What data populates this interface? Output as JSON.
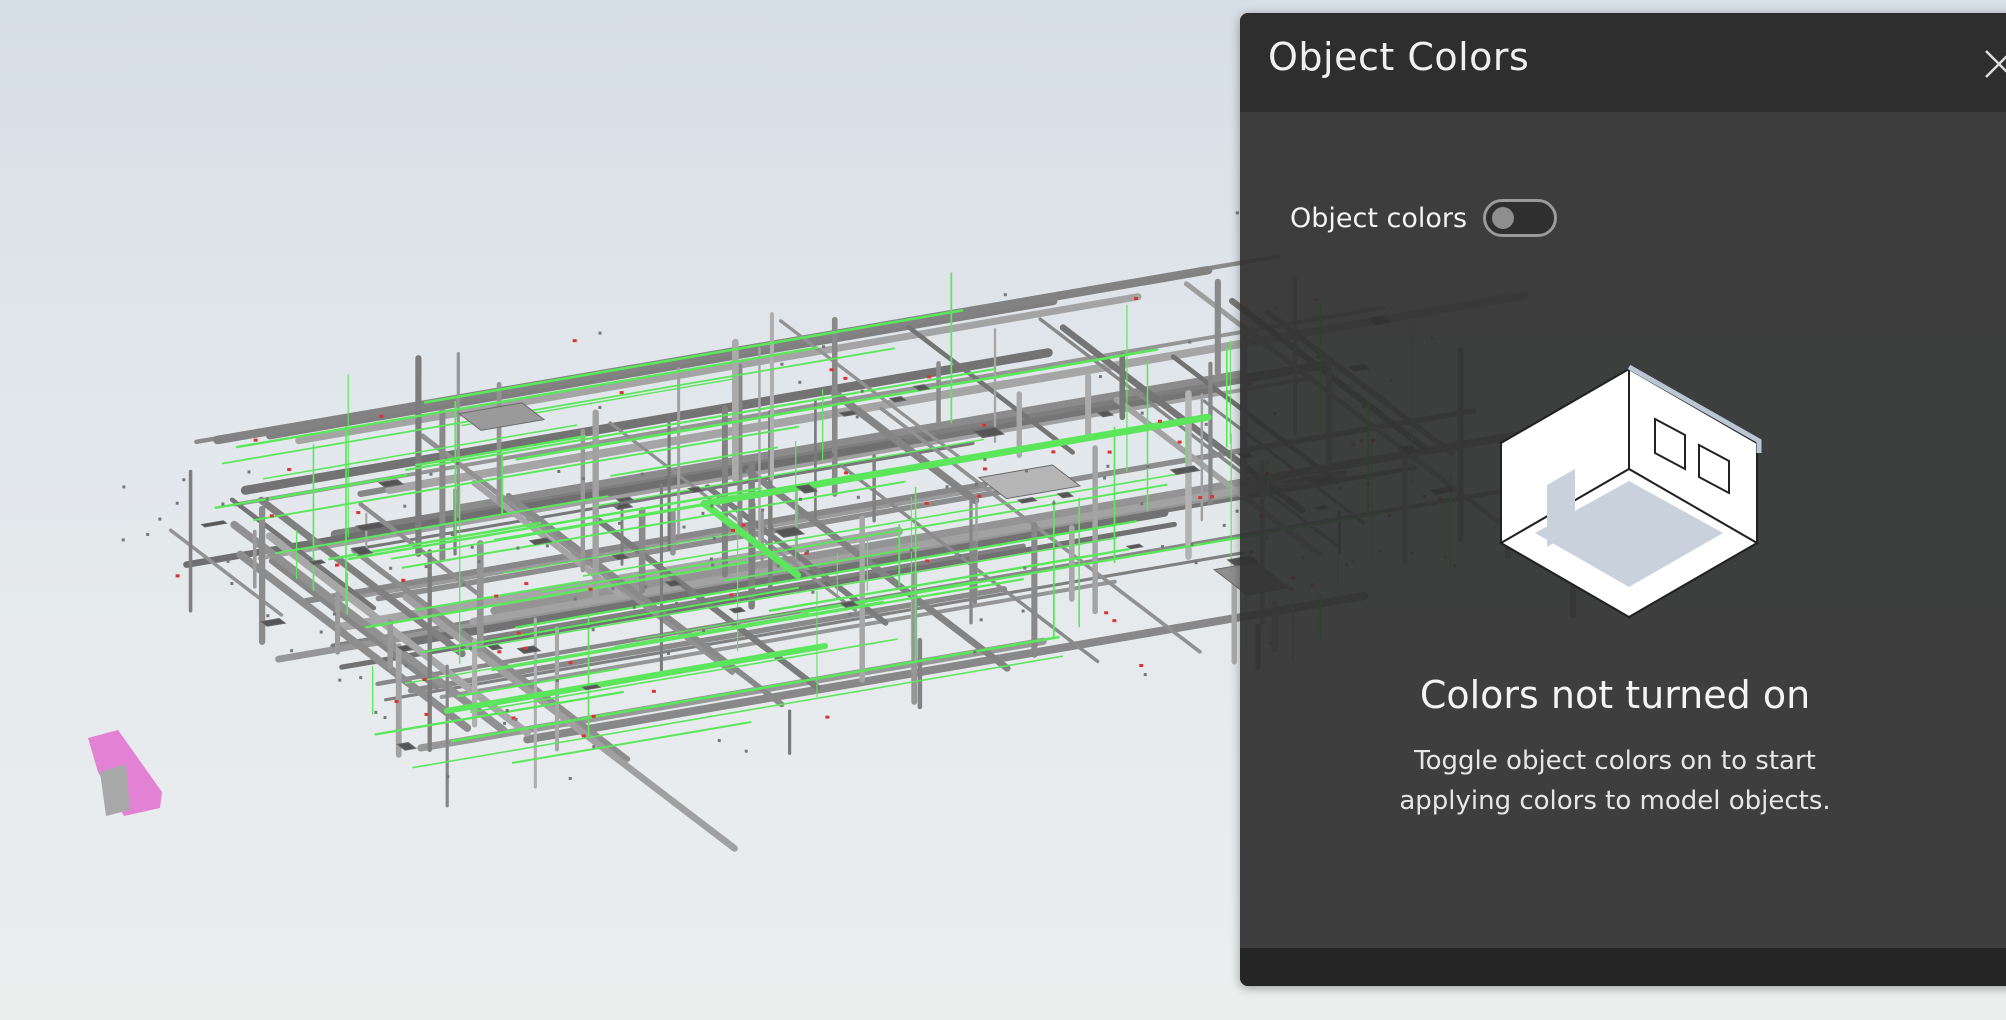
{
  "panel": {
    "title": "Object Colors",
    "close_icon": "close-icon",
    "toggle": {
      "label": "Object colors",
      "state": "off"
    },
    "empty_state": {
      "illustration_icon": "room-cube-icon",
      "title": "Colors not turned on",
      "description_line1": "Toggle object colors on to start",
      "description_line2": "applying colors to model objects."
    }
  },
  "colors": {
    "panel_bg": "#303030",
    "header_bg": "#2e2e2e",
    "highlight_green": "#5ce65c",
    "pink_element": "#e26fd0"
  }
}
